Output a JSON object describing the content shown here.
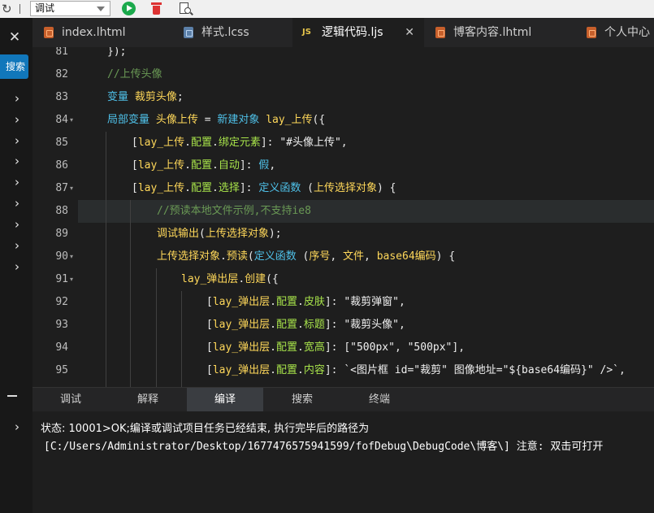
{
  "toolbar": {
    "refresh_icon": "refresh-icon",
    "mode_select_value": "调试",
    "run_icon": "play-icon",
    "clear_icon": "trash-icon",
    "find_icon": "find-in-file-icon"
  },
  "sidebar": {
    "close_label": "✕",
    "search_label": "搜索",
    "chevron": "›",
    "bottom_chevron": "›"
  },
  "tabs": [
    {
      "label": "index.lhtml",
      "icon": "html"
    },
    {
      "label": "样式.lcss",
      "icon": "css"
    },
    {
      "label": "逻辑代码.ljs",
      "icon": "js",
      "active": true,
      "close": "✕"
    },
    {
      "label": "博客内容.lhtml",
      "icon": "html"
    },
    {
      "label": "个人中心",
      "icon": "html"
    }
  ],
  "editor": {
    "js_badge": "JS",
    "lines": [
      {
        "num": "81",
        "text": "});"
      },
      {
        "num": "82",
        "text": "//上传头像"
      },
      {
        "num": "83",
        "text": "变量 裁剪头像;"
      },
      {
        "num": "84",
        "text": "局部变量 头像上传 = 新建对象 lay_上传({"
      },
      {
        "num": "85",
        "text": "[lay_上传.配置.绑定元素]: \"#头像上传\","
      },
      {
        "num": "86",
        "text": "[lay_上传.配置.自动]: 假,"
      },
      {
        "num": "87",
        "text": "[lay_上传.配置.选择]: 定义函数 (上传选择对象) {"
      },
      {
        "num": "88",
        "text": "//预读本地文件示例,不支持ie8"
      },
      {
        "num": "89",
        "text": "调试输出(上传选择对象);"
      },
      {
        "num": "90",
        "text": "上传选择对象.预读(定义函数 (序号, 文件, base64编码) {"
      },
      {
        "num": "91",
        "text": "lay_弹出层.创建({"
      },
      {
        "num": "92",
        "text": "[lay_弹出层.配置.皮肤]: \"裁剪弹窗\","
      },
      {
        "num": "93",
        "text": "[lay_弹出层.配置.标题]: \"裁剪头像\","
      },
      {
        "num": "94",
        "text": "[lay_弹出层.配置.宽高]: [\"500px\", \"500px\"],"
      },
      {
        "num": "95",
        "text": "[lay_弹出层.配置.内容]: `<图片框 id=\"裁剪\" 图像地址=\"${base64编码}\" />`,"
      }
    ]
  },
  "panel": {
    "tabs": [
      "调试",
      "解释",
      "编译",
      "搜索",
      "终端"
    ],
    "active_tab": "编译",
    "output_line1": "状态: 10001>OK;编译或调试项目任务已经结束, 执行完毕后的路径为",
    "output_line2": "[C:/Users/Administrator/Desktop/1677476575941599/fofDebug\\DebugCode\\博客\\] 注意: 双击可打开"
  }
}
